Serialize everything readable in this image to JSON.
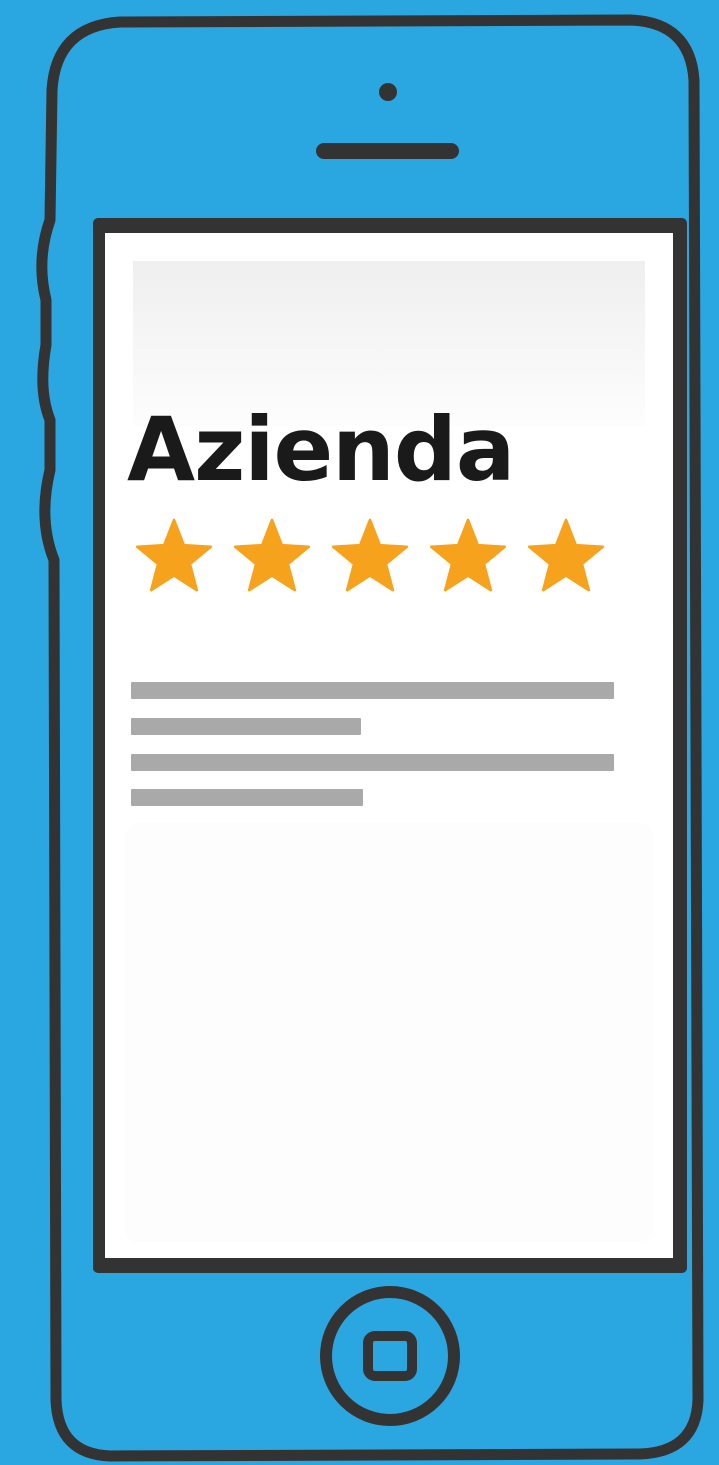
{
  "phone": {
    "body_color": "#2aa6e0",
    "outline_color": "#333333",
    "screen_color": "#ffffff"
  },
  "app": {
    "title": "Azienda",
    "rating": {
      "value": 5,
      "max": 5,
      "star_color": "#f6a21c",
      "icon": "star-icon"
    }
  },
  "icons": {
    "camera": "camera-dot-icon",
    "speaker": "speaker-slot-icon",
    "home": "home-button-icon"
  }
}
